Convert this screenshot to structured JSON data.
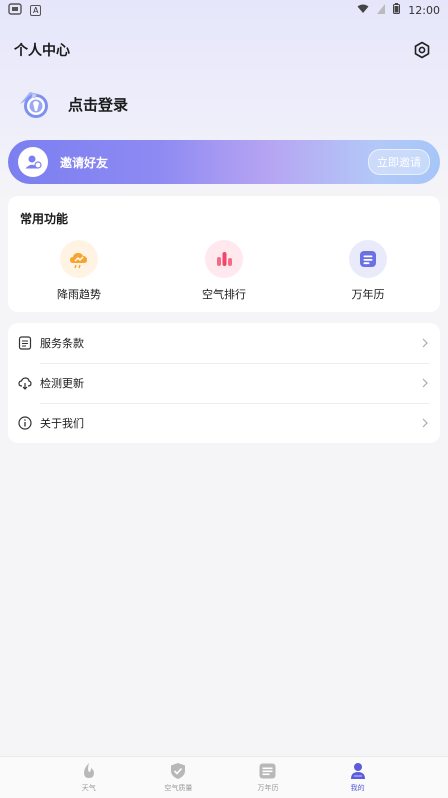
{
  "status_bar": {
    "left_badge": "A",
    "time": "12:00"
  },
  "header": {
    "title": "个人中心"
  },
  "profile": {
    "login_text": "点击登录"
  },
  "invite": {
    "text": "邀请好友",
    "button": "立即邀请"
  },
  "functions": {
    "title": "常用功能",
    "items": [
      {
        "label": "降雨趋势",
        "icon": "rain-trend-icon"
      },
      {
        "label": "空气排行",
        "icon": "air-ranking-icon"
      },
      {
        "label": "万年历",
        "icon": "calendar-icon"
      }
    ]
  },
  "menu": {
    "items": [
      {
        "label": "服务条款",
        "icon": "document-icon"
      },
      {
        "label": "检测更新",
        "icon": "cloud-update-icon"
      },
      {
        "label": "关于我们",
        "icon": "info-icon"
      }
    ]
  },
  "bottom_nav": {
    "items": [
      {
        "label": "天气",
        "icon": "weather-icon"
      },
      {
        "label": "空气质量",
        "icon": "shield-icon"
      },
      {
        "label": "万年历",
        "icon": "calendar-nav-icon"
      },
      {
        "label": "我的",
        "icon": "user-icon"
      }
    ],
    "active_index": 3
  },
  "colors": {
    "accent": "#5b5bdb",
    "background": "#f5f5f7"
  }
}
